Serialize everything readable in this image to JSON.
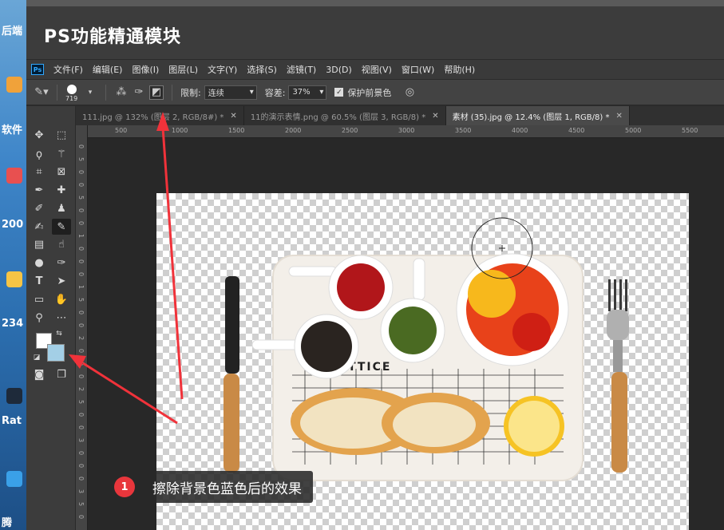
{
  "desktop": {
    "labels": [
      "后端",
      "软件",
      "200",
      "234",
      "Rat",
      "腾"
    ]
  },
  "banner": {
    "title": "PS功能精通模块"
  },
  "menubar": {
    "logo": "Ps",
    "items": [
      "文件(F)",
      "编辑(E)",
      "图像(I)",
      "图层(L)",
      "文字(Y)",
      "选择(S)",
      "滤镜(T)",
      "3D(D)",
      "视图(V)",
      "窗口(W)",
      "帮助(H)"
    ]
  },
  "options": {
    "brush_size": "719",
    "limit_label": "限制:",
    "limit_value": "连续",
    "tolerance_label": "容差:",
    "tolerance_value": "37%",
    "protect_label": "保护前景色"
  },
  "tabs": [
    {
      "label": "111.jpg @ 132% (图层 2, RGB/8#) *",
      "active": false
    },
    {
      "label": "11的演示表情.png @ 60.5% (图层 3, RGB/8) *",
      "active": false
    },
    {
      "label": "素材 (35).jpg @ 12.4% (图层 1, RGB/8) *",
      "active": true
    }
  ],
  "ruler": {
    "h_ticks": [
      "500",
      "1000",
      "1500",
      "2000",
      "2500",
      "3000",
      "3500",
      "4000",
      "4500",
      "5000",
      "5500"
    ],
    "v_ticks": [
      "0",
      "5",
      "0",
      "0",
      "5",
      "0",
      "0",
      "1",
      "0",
      "0",
      "0",
      "1",
      "5",
      "0",
      "0",
      "2",
      "0",
      "0",
      "0",
      "2",
      "5",
      "0",
      "0",
      "3",
      "0",
      "0",
      "0",
      "3",
      "5",
      "0"
    ]
  },
  "photo": {
    "tray_text": "TTICE"
  },
  "annotation": {
    "number": "1",
    "text": "擦除背景色蓝色后的效果"
  },
  "colors": {
    "accent_red": "#e8363c",
    "bg_swatch": "#a3cfe6",
    "ps_blue": "#31a8ff"
  }
}
